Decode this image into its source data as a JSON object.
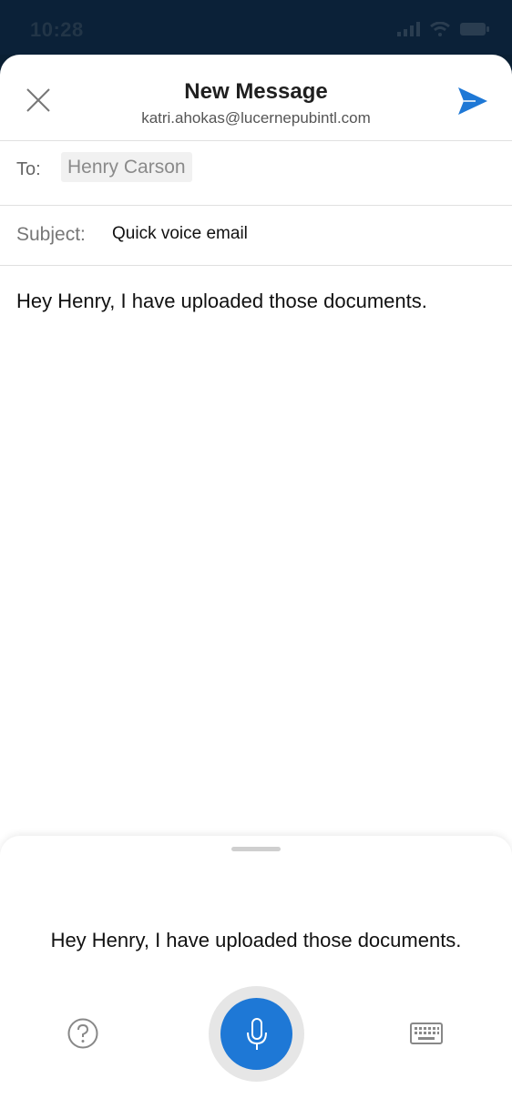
{
  "status_bar": {
    "time": "10:28"
  },
  "header": {
    "title": "New Message",
    "account": "katri.ahokas@lucernepubintl.com"
  },
  "to": {
    "label": "To:",
    "recipient": "Henry Carson"
  },
  "subject": {
    "label": "Subject:",
    "value": "Quick voice email"
  },
  "body": {
    "text": "Hey Henry, I have uploaded those documents."
  },
  "voice_panel": {
    "transcript": "Hey Henry, I have uploaded those documents."
  },
  "colors": {
    "accent": "#1e78d6",
    "status_bar_bg": "#0b2138"
  },
  "icons": [
    "close-icon",
    "send-icon",
    "help-icon",
    "microphone-icon",
    "keyboard-icon",
    "signal-icon",
    "wifi-icon",
    "battery-icon"
  ]
}
